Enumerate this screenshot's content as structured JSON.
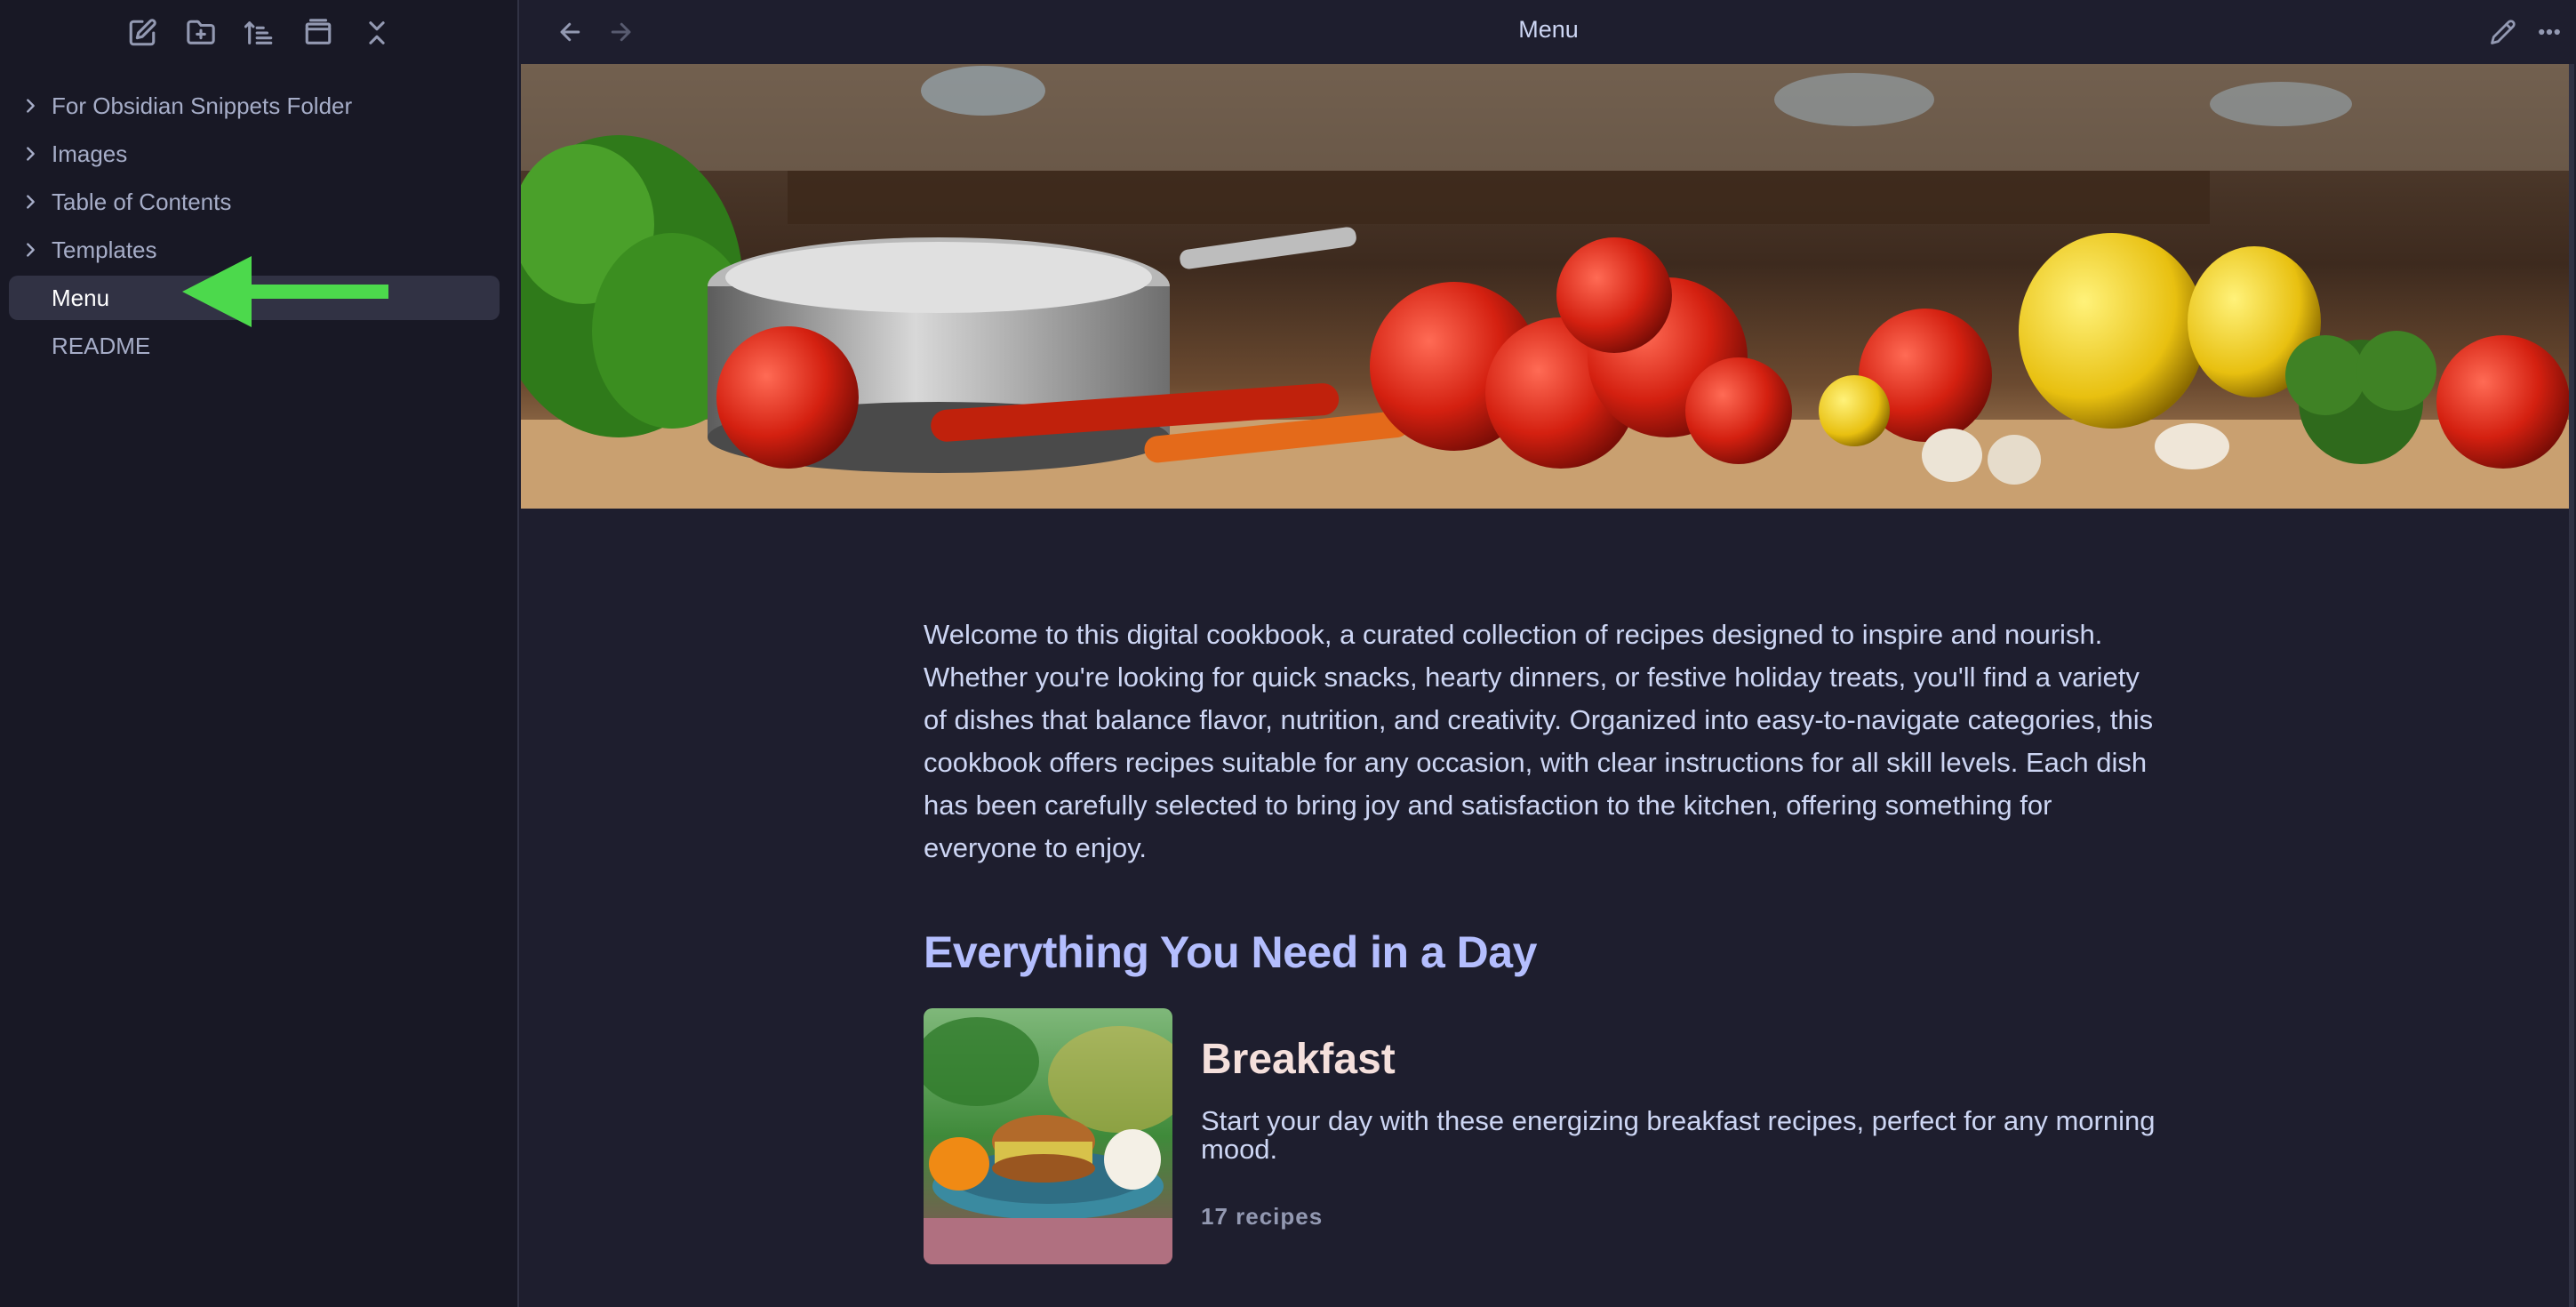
{
  "sidebar": {
    "toolbar": [
      {
        "icon": "new-note-icon"
      },
      {
        "icon": "new-folder-icon"
      },
      {
        "icon": "sort-icon"
      },
      {
        "icon": "collapse-view-icon"
      },
      {
        "icon": "collapse-all-icon"
      }
    ],
    "folders": [
      {
        "label": "For Obsidian Snippets Folder"
      },
      {
        "label": "Images"
      },
      {
        "label": "Table of Contents"
      },
      {
        "label": "Templates"
      }
    ],
    "files": [
      {
        "label": "Menu",
        "active": true
      },
      {
        "label": "README",
        "active": false
      }
    ],
    "annotation_color": "#4cd94c"
  },
  "main": {
    "view_title": "Menu",
    "intro": "Welcome to this digital cookbook, a curated collection of recipes designed to inspire and nourish. Whether you're looking for quick snacks, hearty dinners, or festive holiday treats, you'll find a variety of dishes that balance flavor, nutrition, and creativity. Organized into easy-to-navigate categories, this cookbook offers recipes suitable for any occasion, with clear instructions for all skill levels. Each dish has been carefully selected to bring joy and satisfaction to the kitchen, offering something for everyone to enjoy.",
    "section_heading": "Everything You Need in a Day",
    "card": {
      "title": "Breakfast",
      "description": "Start your day with these energizing breakfast recipes, perfect for any morning mood.",
      "count": "17 recipes"
    }
  },
  "colors": {
    "background": "#1e1e2e",
    "sidebar": "#181825",
    "heading": "#b4befe",
    "card_title": "#f5e0dc"
  }
}
